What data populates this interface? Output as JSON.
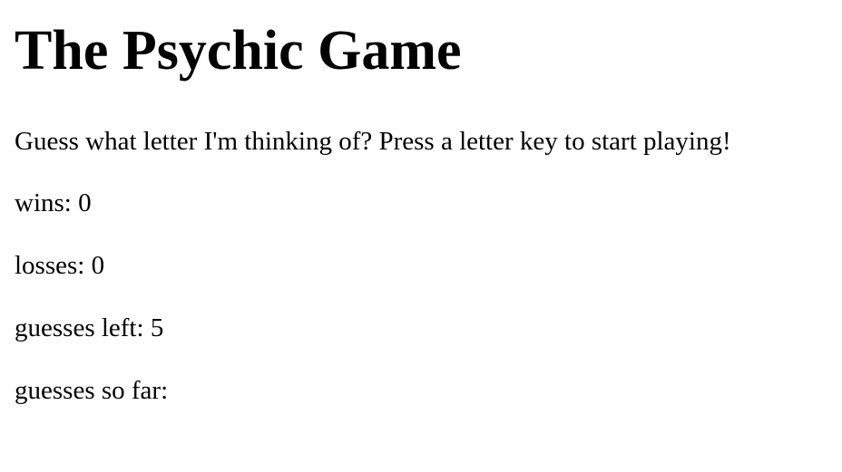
{
  "game": {
    "title": "The Psychic Game",
    "instructions": "Guess what letter I'm thinking of? Press a letter key to start playing!",
    "wins_label": "wins: ",
    "wins": "0",
    "losses_label": "losses: ",
    "losses": "0",
    "guesses_left_label": "guesses left: ",
    "guesses_left": "5",
    "guesses_so_far_label": "guesses so far:",
    "guesses_so_far": ""
  }
}
